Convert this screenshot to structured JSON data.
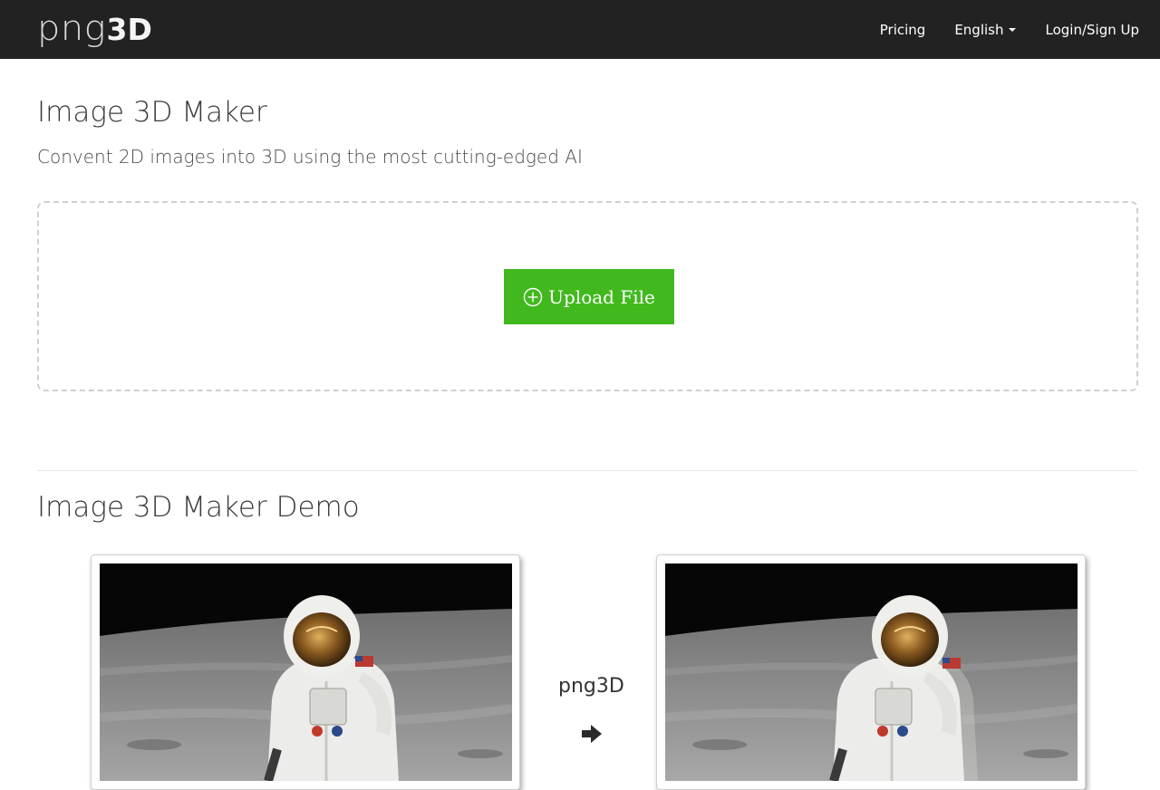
{
  "navbar": {
    "logo_light": "png",
    "logo_bold": "3D",
    "links": {
      "pricing": "Pricing",
      "language": "English",
      "login": "Login/Sign Up"
    }
  },
  "main": {
    "title": "Image 3D Maker",
    "subtitle": "Convent 2D images into 3D using the most cutting-edged AI",
    "upload_button": "Upload File",
    "upload_icon": "plus-circle-icon"
  },
  "demo": {
    "title": "Image 3D Maker Demo",
    "arrow_label": "png3D",
    "arrow_icon": "arrow-right-icon"
  },
  "colors": {
    "navbar_bg": "#222222",
    "upload_green": "#41b91e",
    "dropzone_border": "#cfcfcf"
  }
}
